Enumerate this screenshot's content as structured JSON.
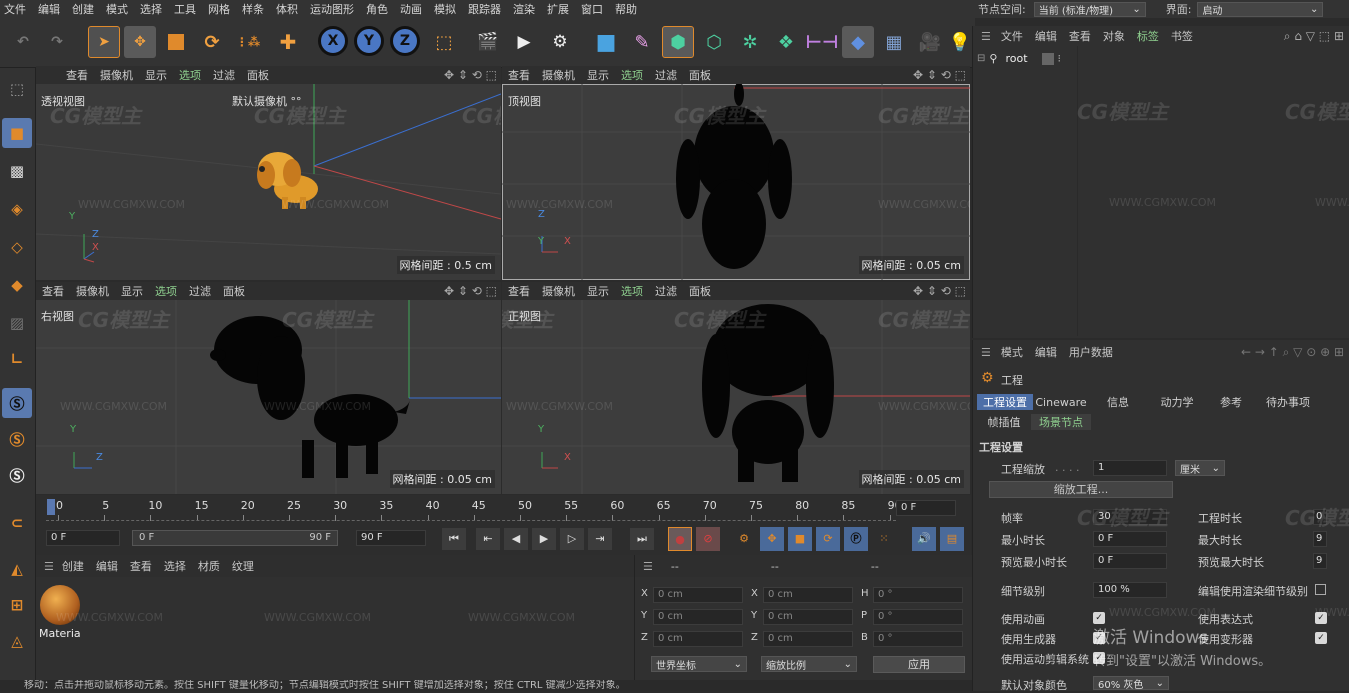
{
  "menu": [
    "文件",
    "编辑",
    "创建",
    "模式",
    "选择",
    "工具",
    "网格",
    "样条",
    "体积",
    "运动图形",
    "角色",
    "动画",
    "模拟",
    "跟踪器",
    "渲染",
    "扩展",
    "窗口",
    "帮助"
  ],
  "node_space": {
    "label": "节点空间:",
    "value": "当前 (标准/物理)"
  },
  "interface": {
    "label": "界面:",
    "value": "启动"
  },
  "toolbar_axes": [
    "X",
    "Y",
    "Z"
  ],
  "viewports": [
    {
      "id": "persp",
      "menu": [
        "查看",
        "摄像机",
        "显示",
        "选项",
        "过滤",
        "面板"
      ],
      "name": "透视视图",
      "camera": "默认摄像机 °°",
      "grid": "网格间距 : 0.5 cm"
    },
    {
      "id": "top",
      "menu": [
        "查看",
        "摄像机",
        "显示",
        "选项",
        "过滤",
        "面板"
      ],
      "name": "顶视图",
      "grid": "网格间距 : 0.05 cm"
    },
    {
      "id": "right",
      "menu": [
        "查看",
        "摄像机",
        "显示",
        "选项",
        "过滤",
        "面板"
      ],
      "name": "右视图",
      "grid": "网格间距 : 0.05 cm"
    },
    {
      "id": "front",
      "menu": [
        "查看",
        "摄像机",
        "显示",
        "选项",
        "过滤",
        "面板"
      ],
      "name": "正视图",
      "grid": "网格间距 : 0.05 cm"
    }
  ],
  "axis_labels": {
    "x": "X",
    "y": "Y",
    "z": "Z"
  },
  "watermark": {
    "logo": "CG模型主",
    "url": "WWW.CGMXW.COM"
  },
  "timeline": {
    "ticks": [
      "0",
      "5",
      "10",
      "15",
      "20",
      "25",
      "30",
      "35",
      "40",
      "45",
      "50",
      "55",
      "60",
      "65",
      "70",
      "75",
      "80",
      "85",
      "90"
    ],
    "current_frame": "0 F",
    "start": "0 F",
    "range_start": "0 F",
    "range_end": "90 F",
    "end": "90 F"
  },
  "material": {
    "menu": [
      "创建",
      "编辑",
      "查看",
      "选择",
      "材质",
      "纹理"
    ],
    "item": "Materia"
  },
  "coords": {
    "header": [
      "--",
      "--",
      "--"
    ],
    "rows": [
      {
        "a": "X",
        "av": "0 cm",
        "b": "X",
        "bv": "0 cm",
        "c": "H",
        "cv": "0 °"
      },
      {
        "a": "Y",
        "av": "0 cm",
        "b": "Y",
        "bv": "0 cm",
        "c": "P",
        "cv": "0 °"
      },
      {
        "a": "Z",
        "av": "0 cm",
        "b": "Z",
        "bv": "0 cm",
        "c": "B",
        "cv": "0 °"
      }
    ],
    "world": "世界坐标",
    "scale": "缩放比例",
    "apply": "应用"
  },
  "objects": {
    "menu": [
      "文件",
      "编辑",
      "查看",
      "对象",
      "标签",
      "书签"
    ],
    "root": "root"
  },
  "attributes": {
    "menu": [
      "模式",
      "编辑",
      "用户数据"
    ],
    "title": "工程",
    "tabs": [
      "工程设置",
      "Cineware",
      "信息",
      "动力学",
      "参考",
      "待办事项"
    ],
    "subtabs": [
      "帧插值",
      "场景节点"
    ],
    "section": "工程设置",
    "scale_label": "工程缩放",
    "scale_value": "1",
    "scale_unit": "厘米",
    "scale_btn": "缩放工程...",
    "fps_label": "帧率",
    "fps_value": "30",
    "duration_label": "工程时长",
    "duration_value": "0",
    "min_label": "最小时长",
    "min_value": "0 F",
    "max_label": "最大时长",
    "max_value": "9",
    "pmin_label": "预览最小时长",
    "pmin_value": "0 F",
    "pmax_label": "预览最大时长",
    "pmax_value": "9",
    "lod_label": "细节级别",
    "lod_value": "100 %",
    "lod_render_label": "编辑使用渲染细节级别",
    "anim_label": "使用动画",
    "expr_label": "使用表达式",
    "gen_label": "使用生成器",
    "deform_label": "使用变形器",
    "motion_label": "使用运动剪辑系统",
    "default_label": "默认对象颜色",
    "default_value": "60% 灰色"
  },
  "activation": {
    "line1": "激活 Windows",
    "line2": "转到\"设置\"以激活 Windows。"
  },
  "status": "移动：点击并拖动鼠标移动元素。按住 SHIFT 键量化移动；节点编辑模式时按住 SHIFT 键增加选择对象；按住 CTRL 键减少选择对象。"
}
